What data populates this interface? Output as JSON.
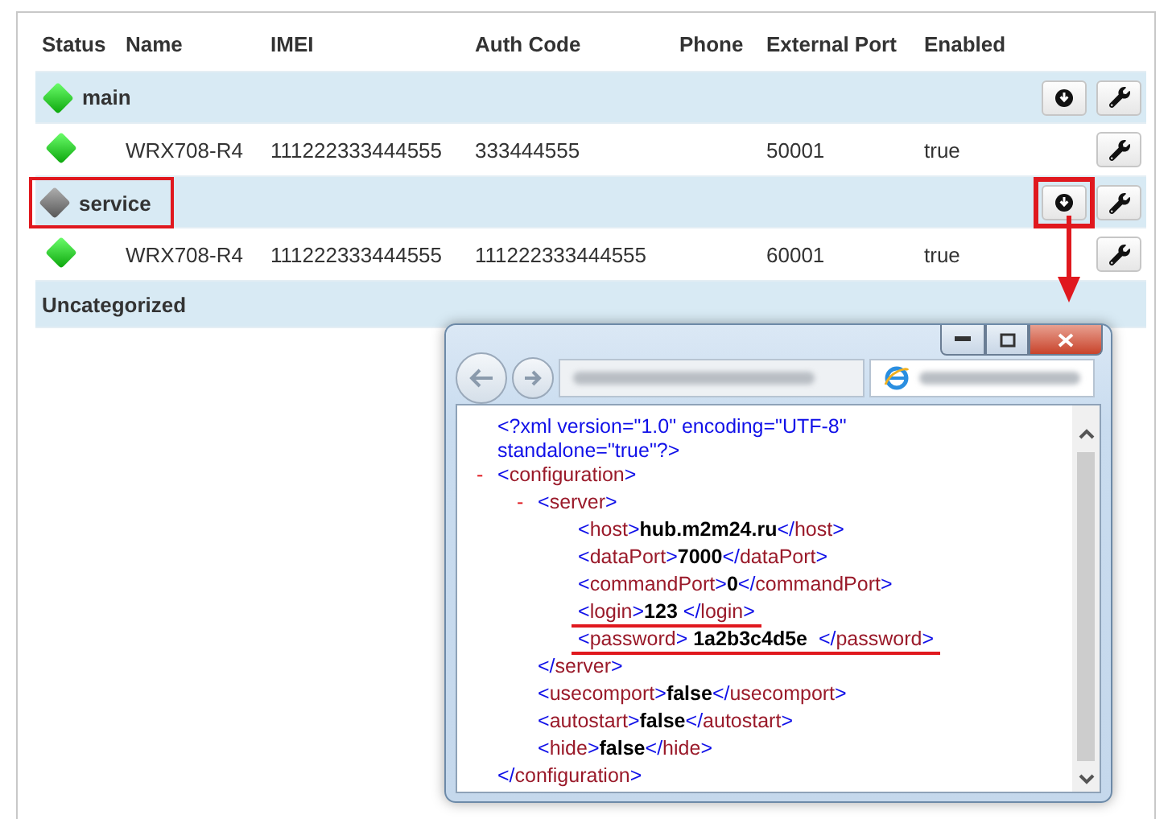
{
  "table": {
    "columns": [
      "Status",
      "Name",
      "IMEI",
      "Auth Code",
      "Phone",
      "External Port",
      "Enabled"
    ],
    "rows": [
      {
        "kind": "group",
        "name": "main",
        "online": true,
        "highlighted": false,
        "download": true,
        "download_highlighted": false
      },
      {
        "kind": "device",
        "online": true,
        "cells": [
          "WRX708-R4",
          "111222333444555",
          "333444555",
          "",
          "50001",
          "true"
        ]
      },
      {
        "kind": "group",
        "name": "service",
        "online": false,
        "highlighted": true,
        "download": true,
        "download_highlighted": true
      },
      {
        "kind": "device",
        "online": true,
        "cells": [
          "WRX708-R4",
          "111222333444555",
          "111222333444555",
          "",
          "60001",
          "true"
        ]
      },
      {
        "kind": "category",
        "name": "Uncategorized"
      }
    ]
  },
  "browser": {
    "declaration": "<?xml version=\"1.0\" encoding=\"UTF-8\" standalone=\"true\"?>",
    "root": {
      "toggle": "-",
      "open": "<configuration>",
      "close": "</configuration>",
      "children": [
        {
          "toggle": "-",
          "open": "<server>",
          "close": "</server>",
          "children": [
            {
              "open": "<host>",
              "value": "hub.m2m24.ru",
              "close": "</host>",
              "underlined": false
            },
            {
              "open": "<dataPort>",
              "value": "7000",
              "close": "</dataPort>",
              "underlined": false
            },
            {
              "open": "<commandPort>",
              "value": "0",
              "close": "</commandPort>",
              "underlined": false
            },
            {
              "open": "<login>",
              "value": "123 ",
              "close": "</login>",
              "underlined": true
            },
            {
              "open": "<password>",
              "value": " 1a2b3c4d5e ",
              "close": " </password>",
              "underlined": true
            }
          ]
        },
        {
          "open": "<usecomport>",
          "value": "false",
          "close": "</usecomport>",
          "underlined": false
        },
        {
          "open": "<autostart>",
          "value": "false",
          "close": "</autostart>",
          "underlined": false
        },
        {
          "open": "<hide>",
          "value": "false",
          "close": "</hide>",
          "underlined": false
        }
      ]
    }
  }
}
